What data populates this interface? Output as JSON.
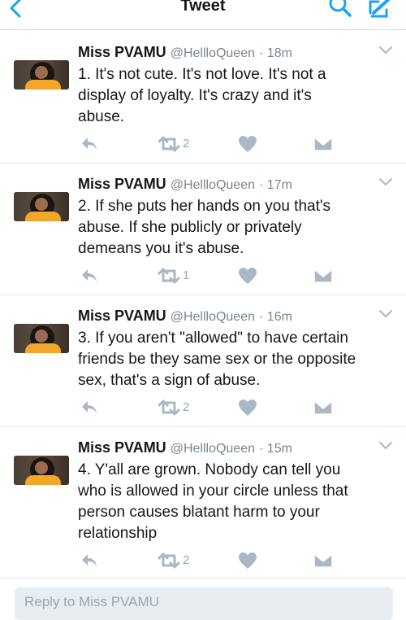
{
  "header": {
    "title": "Tweet"
  },
  "icons": {
    "back": "back-chevron-icon",
    "search": "search-icon",
    "compose": "compose-icon",
    "reply": "reply-icon",
    "retweet": "retweet-icon",
    "like": "heart-icon",
    "dm": "direct-message-icon",
    "more": "chevron-down-icon"
  },
  "colors": {
    "accent": "#1da1f2",
    "action": "#a9b8c4",
    "muted": "#7a858f"
  },
  "tweets": [
    {
      "name": "Miss PVAMU",
      "handle": "@HellloQueen",
      "time": "· 18m",
      "text": "1. It's not cute. It's not love. It's not a\ndisplay of loyalty. It's crazy and it's\nabuse.",
      "retweets": "2"
    },
    {
      "name": "Miss PVAMU",
      "handle": "@HellloQueen",
      "time": "· 17m",
      "text": "2. If she puts her hands on you that's\nabuse. If she publicly or privately\ndemeans you it's abuse.",
      "retweets": "1"
    },
    {
      "name": "Miss PVAMU",
      "handle": "@HellloQueen",
      "time": "· 16m",
      "text": "3. If you aren't \"allowed\" to have certain\nfriends be they same sex or the opposite\nsex, that's a sign of abuse.",
      "retweets": "2"
    },
    {
      "name": "Miss PVAMU",
      "handle": "@HellloQueen",
      "time": "· 15m",
      "text": "4. Y'all are grown. Nobody can tell you\nwho is allowed in your circle unless that\nperson causes blatant harm to your\nrelationship",
      "retweets": "2"
    }
  ],
  "reply_box": {
    "placeholder": "Reply to Miss PVAMU"
  }
}
